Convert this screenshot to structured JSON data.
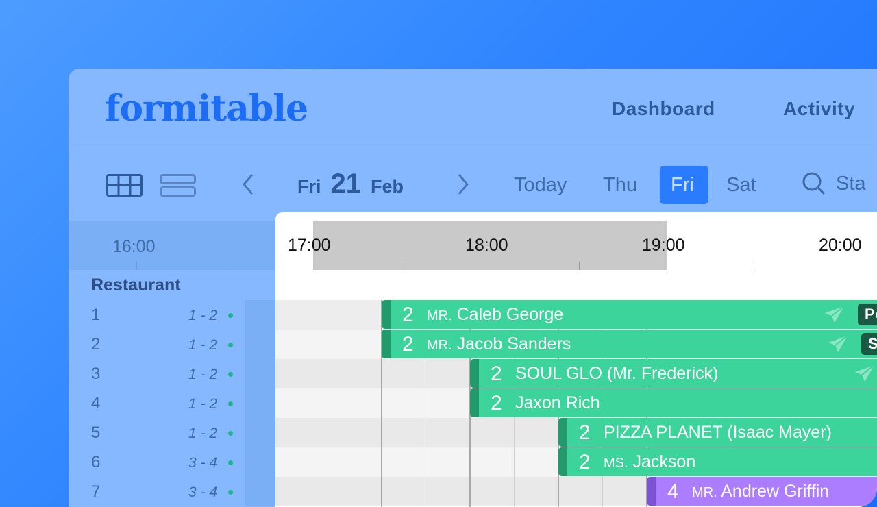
{
  "brand": {
    "logo": "formitable"
  },
  "nav": {
    "dashboard": "Dashboard",
    "activity": "Activity"
  },
  "toolbar": {
    "date_day": "Fri",
    "date_num": "21",
    "date_month": "Feb",
    "days": {
      "today": "Today",
      "thu": "Thu",
      "fri": "Fri",
      "sat": "Sat"
    },
    "active_day": "Fri",
    "search_partial": "Sta"
  },
  "timeline": {
    "left_hour": "16:00",
    "hours": [
      "17:00",
      "18:00",
      "19:00",
      "20:00"
    ]
  },
  "section_label": "Restaurant",
  "tables": [
    {
      "num": "1",
      "capacity": "1 - 2"
    },
    {
      "num": "2",
      "capacity": "1 - 2"
    },
    {
      "num": "3",
      "capacity": "1 - 2"
    },
    {
      "num": "4",
      "capacity": "1 - 2"
    },
    {
      "num": "5",
      "capacity": "1 - 2"
    },
    {
      "num": "6",
      "capacity": "3 - 4"
    },
    {
      "num": "7",
      "capacity": "3 - 4"
    }
  ],
  "bookings": [
    {
      "guests": "2",
      "salutation": "MR.",
      "name": "Caleb George",
      "tag": "Po"
    },
    {
      "guests": "2",
      "salutation": "MR.",
      "name": "Jacob Sanders",
      "tag": "Ss"
    },
    {
      "guests": "2",
      "salutation": "",
      "name": "SOUL GLO (Mr. Frederick)"
    },
    {
      "guests": "2",
      "salutation": "",
      "name": "Jaxon Rich"
    },
    {
      "guests": "2",
      "salutation": "",
      "name": "PIZZA PLANET (Isaac Mayer)"
    },
    {
      "guests": "2",
      "salutation": "MS.",
      "name": "Jackson"
    },
    {
      "guests": "4",
      "salutation": "MR.",
      "name": "Andrew Griffin"
    }
  ],
  "colors": {
    "booking_green": "#3dd49c",
    "booking_purple": "#ac7eff",
    "accent": "#2b7bff"
  }
}
